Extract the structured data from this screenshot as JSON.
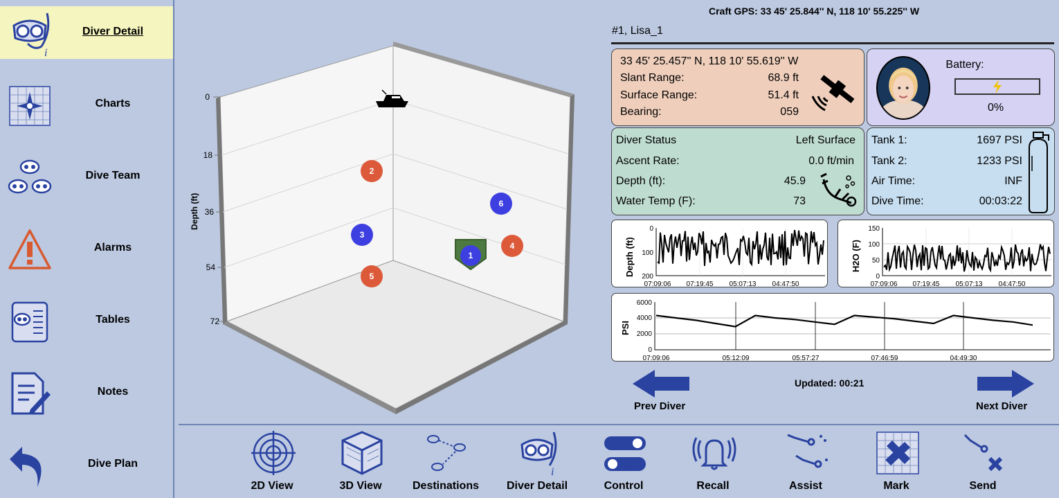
{
  "sidebar": {
    "items": [
      {
        "label": "Diver Detail",
        "icon": "diver-mask-icon",
        "active": true
      },
      {
        "label": "Charts",
        "icon": "compass-chart-icon"
      },
      {
        "label": "Dive Team",
        "icon": "dive-team-icon"
      },
      {
        "label": "Alarms",
        "icon": "warning-triangle-icon"
      },
      {
        "label": "Tables",
        "icon": "dive-tables-icon"
      },
      {
        "label": "Notes",
        "icon": "notes-icon"
      },
      {
        "label": "Dive Plan",
        "icon": "back-arrow-icon"
      }
    ]
  },
  "plot3d": {
    "axis_label": "Depth (ft)",
    "ticks": [
      "0",
      "18",
      "36",
      "54",
      "72"
    ],
    "divers": [
      {
        "number": "1",
        "color": "#3d3fe0",
        "selected": true
      },
      {
        "number": "2",
        "color": "#dc5a3a"
      },
      {
        "number": "3",
        "color": "#3d3fe0"
      },
      {
        "number": "4",
        "color": "#dc5a3a"
      },
      {
        "number": "5",
        "color": "#dc5a3a"
      },
      {
        "number": "6",
        "color": "#3d3fe0"
      }
    ]
  },
  "header": {
    "craft_gps": "Craft GPS: 33 45' 25.844'' N, 118 10' 55.225'' W",
    "diver_name": "#1, Lisa_1"
  },
  "location": {
    "coords": "33 45' 25.457'' N, 118 10' 55.619'' W",
    "rows": [
      {
        "label": "Slant Range:",
        "value": "68.9 ft"
      },
      {
        "label": "Surface Range:",
        "value": "51.4 ft"
      },
      {
        "label": "Bearing:",
        "value": "059"
      }
    ]
  },
  "battery": {
    "label": "Battery:",
    "value": "0%",
    "level": 0
  },
  "status": {
    "rows": [
      {
        "label": "Diver Status",
        "value": "Left Surface"
      },
      {
        "label": "Ascent Rate:",
        "value": "0.0 ft/min"
      },
      {
        "label": "Depth (ft):",
        "value": "45.9"
      },
      {
        "label": "Water Temp (F):",
        "value": "73"
      }
    ]
  },
  "tanks": {
    "rows": [
      {
        "label": "Tank 1:",
        "value": "1697 PSI"
      },
      {
        "label": "Tank 2:",
        "value": "1233 PSI"
      },
      {
        "label": "Air Time:",
        "value": "INF"
      },
      {
        "label": "Dive Time:",
        "value": "00:03:22"
      }
    ]
  },
  "chart_data": [
    {
      "type": "line",
      "ylabel": "Depth (ft)",
      "yticks": [
        "0",
        "100",
        "200"
      ],
      "ylim": [
        200,
        0
      ],
      "xticks": [
        "07:09:06",
        "07:19:45",
        "05:07:13",
        "04:47:50"
      ]
    },
    {
      "type": "line",
      "ylabel": "H2O (F)",
      "yticks": [
        "150",
        "100",
        "50",
        "0"
      ],
      "ylim": [
        0,
        150
      ],
      "xticks": [
        "07:09:06",
        "07:19:45",
        "05:07:13",
        "04:47:50"
      ]
    },
    {
      "type": "line",
      "ylabel": "PSI",
      "yticks": [
        "6000",
        "4000",
        "2000",
        "0"
      ],
      "ylim": [
        0,
        6000
      ],
      "xticks": [
        "07:09:06",
        "05:12:09",
        "05:57:27",
        "07:46:59",
        "04:49:30"
      ],
      "series": [
        {
          "values": [
            4300,
            4000,
            3700,
            3300,
            2900,
            4300,
            4000,
            3800,
            3500,
            3200,
            4300,
            4100,
            3900,
            3600,
            3300,
            4300,
            4000,
            3700,
            3500,
            3100
          ]
        }
      ]
    }
  ],
  "nav": {
    "prev": "Prev Diver",
    "next": "Next Diver",
    "updated": "Updated: 00:21"
  },
  "toolbar": {
    "items": [
      {
        "label": "2D View",
        "icon": "target-icon"
      },
      {
        "label": "3D View",
        "icon": "cube-icon"
      },
      {
        "label": "Destinations",
        "icon": "destinations-icon"
      },
      {
        "label": "Diver Detail",
        "icon": "diver-mask-icon"
      },
      {
        "label": "Control",
        "icon": "toggle-switches-icon"
      },
      {
        "label": "Recall",
        "icon": "recall-bell-icon"
      },
      {
        "label": "Assist",
        "icon": "assist-divers-icon"
      },
      {
        "label": "Mark",
        "icon": "mark-map-icon"
      },
      {
        "label": "Send",
        "icon": "send-diver-icon"
      }
    ]
  }
}
